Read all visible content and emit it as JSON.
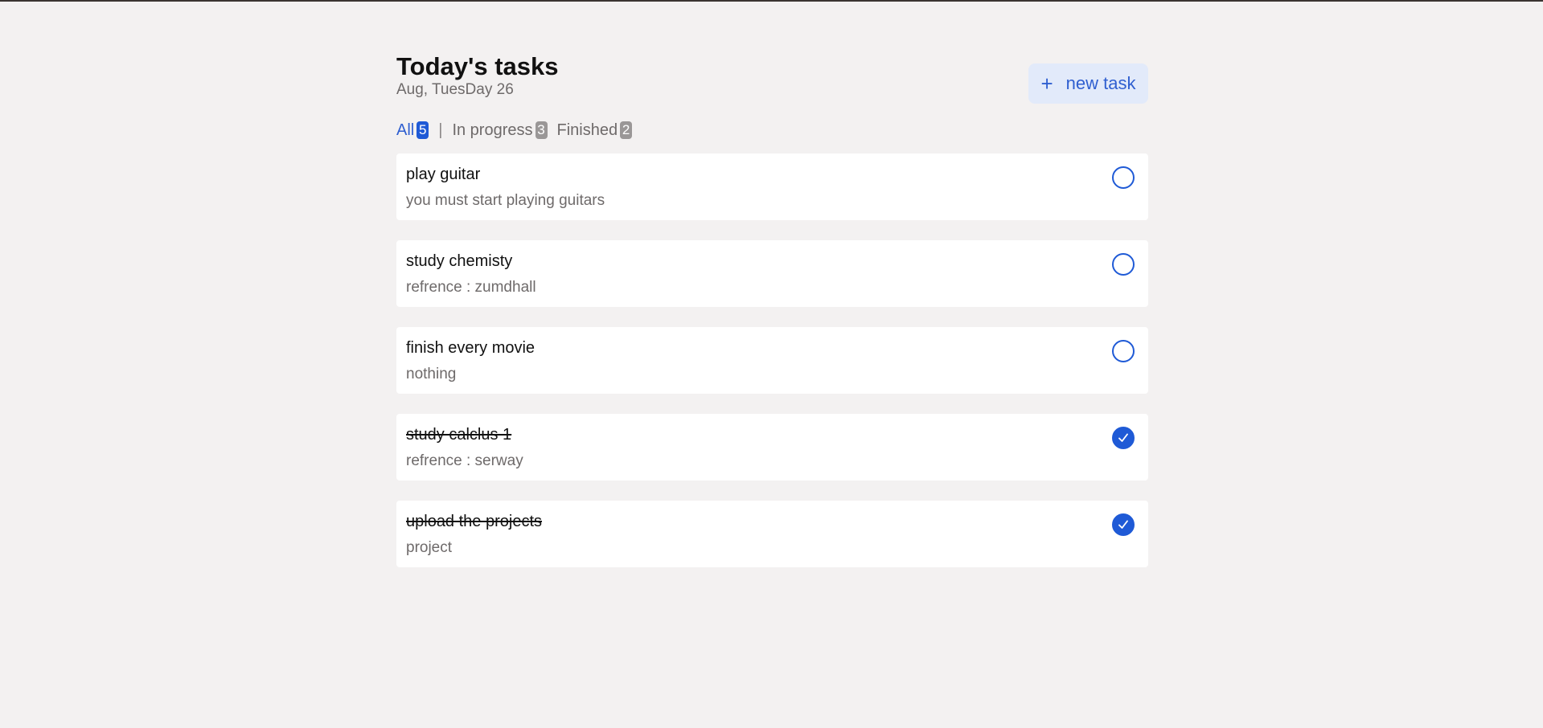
{
  "header": {
    "title": "Today's tasks",
    "date": "Aug, TuesDay 26",
    "new_task_label": "new task",
    "new_task_icon": "+"
  },
  "filters": {
    "all": {
      "label": "All",
      "count": "5"
    },
    "separator": "|",
    "in_progress": {
      "label": "In progress",
      "count": "3"
    },
    "finished": {
      "label": "Finished",
      "count": "2"
    }
  },
  "tasks": [
    {
      "title": "play guitar",
      "description": "you must start playing guitars",
      "done": false
    },
    {
      "title": "study chemisty",
      "description": "refrence : zumdhall",
      "done": false
    },
    {
      "title": "finish every movie",
      "description": "nothing",
      "done": false
    },
    {
      "title": "study calclus 1",
      "description": "refrence : serway",
      "done": true
    },
    {
      "title": "upload the projects",
      "description": "project",
      "done": true
    }
  ],
  "colors": {
    "accent": "#1f5ad6",
    "background": "#f3f1f1",
    "button_bg": "#e2eafa",
    "muted_text": "#6e6a6a",
    "badge_gray": "#9a9797"
  },
  "icons": {
    "new_task": "plus-icon",
    "unchecked": "circle-outline-icon",
    "checked": "check-circle-icon"
  }
}
